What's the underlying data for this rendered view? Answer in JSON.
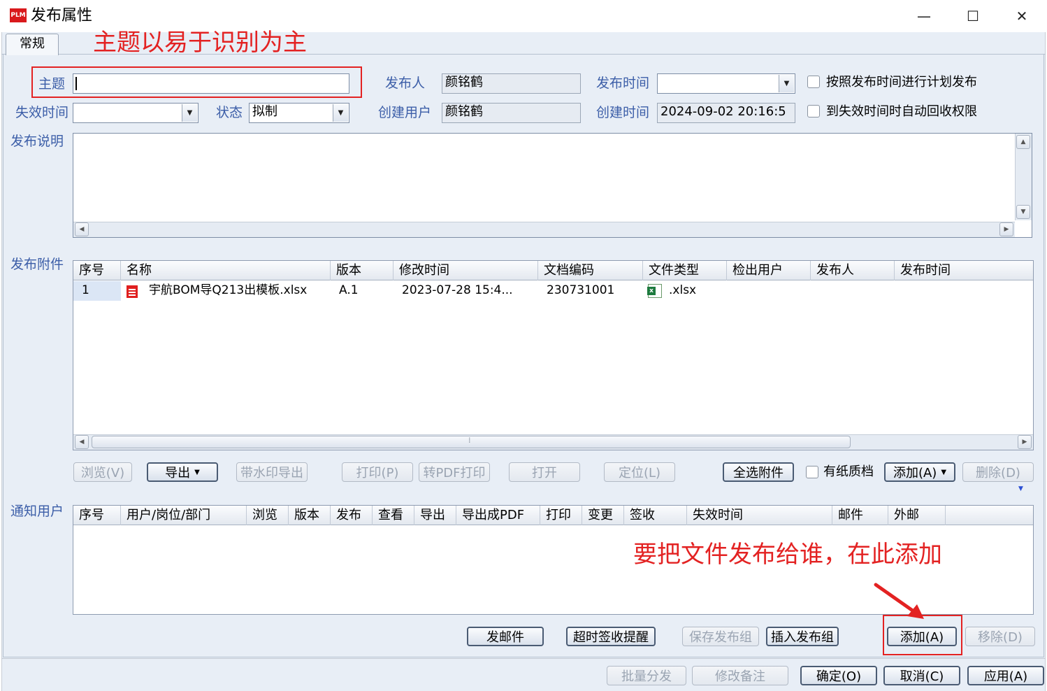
{
  "window": {
    "logo_text": "PLM",
    "title": "发布属性",
    "minimize": "—",
    "maximize": "☐",
    "close": "✕"
  },
  "tabs": {
    "general": "常规"
  },
  "annotations": {
    "subject_hint": "主题以易于识别为主",
    "add_hint": "要把文件发布给谁，在此添加"
  },
  "form": {
    "subject_label": "主题",
    "subject_value": "",
    "publisher_label": "发布人",
    "publisher_value": "颜铭鹤",
    "publish_time_label": "发布时间",
    "publish_time_value": "",
    "scheduled_publish_label": "按照发布时间进行计划发布",
    "expire_time_label": "失效时间",
    "expire_time_value": "",
    "status_label": "状态",
    "status_value": "拟制",
    "creator_label": "创建用户",
    "creator_value": "颜铭鹤",
    "create_time_label": "创建时间",
    "create_time_value": "2024-09-02 20:16:5",
    "auto_revoke_label": "到失效时间时自动回收权限",
    "description_label": "发布说明",
    "attachments_label": "发布附件",
    "notify_label": "通知用户"
  },
  "attachments": {
    "columns": [
      "序号",
      "名称",
      "版本",
      "修改时间",
      "文档编码",
      "文件类型",
      "检出用户",
      "发布人",
      "发布时间"
    ],
    "rows": [
      {
        "index": "1",
        "name": "宇航BOM导Q213出模板.xlsx",
        "version": "A.1",
        "modified": "2023-07-28 15:4...",
        "doc_code": "230731001",
        "file_type": ".xlsx",
        "checkout_user": "",
        "publisher": "",
        "publish_time": ""
      }
    ],
    "scroll_grip": "⁞"
  },
  "attachment_toolbar": {
    "browse": "浏览(V)",
    "export": "导出",
    "export_watermark": "带水印导出",
    "print": "打印(P)",
    "pdf_print": "转PDF打印",
    "open": "打开",
    "locate": "定位(L)",
    "select_all": "全选附件",
    "paper_archive": "有纸质档",
    "add": "添加(A)",
    "delete": "删除(D)"
  },
  "notify": {
    "columns": [
      "序号",
      "用户/岗位/部门",
      "浏览",
      "版本",
      "发布",
      "查看",
      "导出",
      "导出成PDF",
      "打印",
      "变更",
      "签收",
      "失效时间",
      "邮件",
      "外邮"
    ],
    "rows": []
  },
  "notify_toolbar": {
    "send_mail": "发邮件",
    "overdue_reminder": "超时签收提醒",
    "save_group": "保存发布组",
    "insert_group": "插入发布组",
    "add": "添加(A)",
    "remove": "移除(D)"
  },
  "footer": {
    "batch_distribute": "批量分发",
    "edit_note": "修改备注",
    "ok": "确定(O)",
    "cancel": "取消(C)",
    "apply": "应用(A)"
  },
  "colors": {
    "annotation_red": "#e32222",
    "label_blue": "#3c5ea8",
    "panel_bg": "#e8eef6"
  }
}
